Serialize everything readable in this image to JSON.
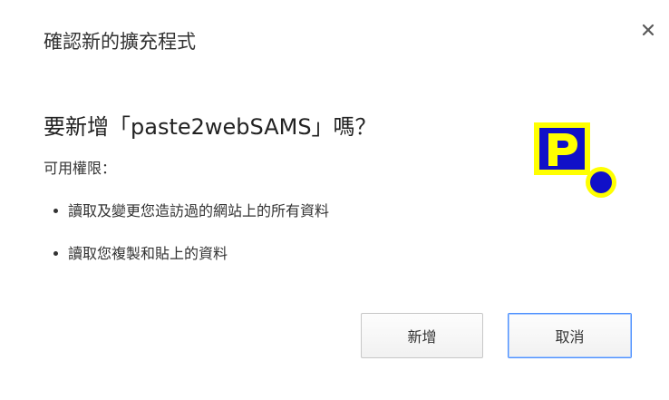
{
  "dialog": {
    "title": "確認新的擴充程式",
    "close_glyph": "×",
    "prompt": "要新增「paste2webSAMS」嗎？",
    "permissions_heading": "可用權限：",
    "permissions": [
      "讀取及變更您造訪過的網站上的所有資料",
      "讀取您複製和貼上的資料"
    ],
    "extension_icon": {
      "name": "paste2webSAMS-logo-icon",
      "letter": "P",
      "colors": {
        "background": "#1010c8",
        "outline": "#ffff00",
        "letter": "#ffff00",
        "dot": "#1010c8"
      }
    },
    "buttons": {
      "add_label": "新增",
      "cancel_label": "取消"
    },
    "accent_color": "#4d90fe"
  }
}
